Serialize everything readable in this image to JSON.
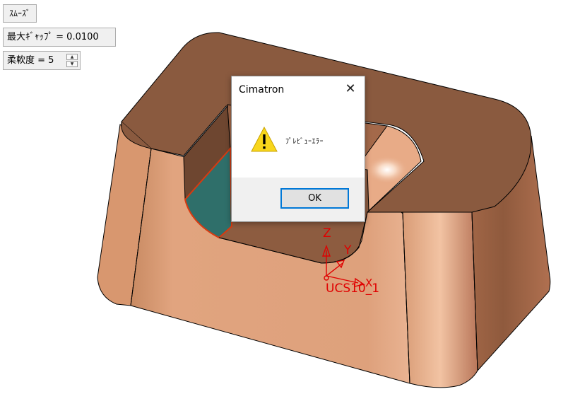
{
  "controls": {
    "smooth_button": "ｽﾑｰｽﾞ",
    "max_gap_label": "最大ｷﾞｬｯﾌﾟ =",
    "max_gap_value": "0.0100",
    "softness_label": "柔軟度 =",
    "softness_value": "5"
  },
  "dialog": {
    "title": "Cimatron",
    "message": "ﾌﾟﾚﾋﾞｭｰｴﾗｰ",
    "ok_label": "OK",
    "icon": "warning-icon"
  },
  "ucs": {
    "name": "UCS10_1",
    "z_label": "Z",
    "y_label": "Y",
    "x_label": "X",
    "color": "#e00000"
  },
  "model": {
    "top_color": "#8a5a3f",
    "side_color": "#dda17d",
    "pocket_floor_color": "#2f6f6a"
  }
}
